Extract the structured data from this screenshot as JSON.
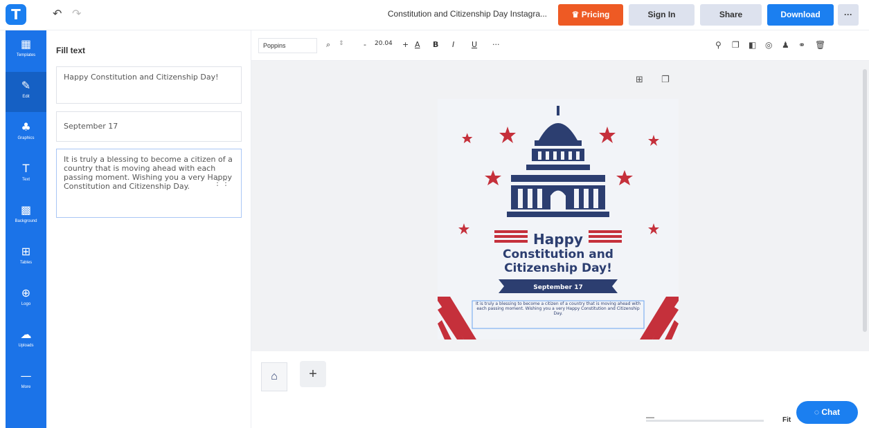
{
  "topbar": {
    "logo": "T",
    "undo_icon": "↶",
    "redo_icon": "↷",
    "title": "Constitution and Citizenship Day Instagra...",
    "pricing": "Pricing",
    "signin": "Sign In",
    "share": "Share",
    "download": "Download",
    "more": "···"
  },
  "sidebar": {
    "items": [
      {
        "icon": "▦",
        "label": "Templates"
      },
      {
        "icon": "✎",
        "label": "Edit"
      },
      {
        "icon": "♣",
        "label": "Graphics"
      },
      {
        "icon": "T",
        "label": "Text"
      },
      {
        "icon": "▩",
        "label": "Background"
      },
      {
        "icon": "⊞",
        "label": "Tables"
      },
      {
        "icon": "⊕",
        "label": "Logo"
      },
      {
        "icon": "☁",
        "label": "Uploads"
      },
      {
        "icon": "—",
        "label": "More"
      }
    ]
  },
  "panel": {
    "title": "Fill text",
    "texts": [
      "Happy Constitution and Citizenship Day!",
      "September 17",
      "It is truly a blessing to become a citizen of a country that is moving ahead with each passing moment. Wishing you a very Happy Constitution and Citizenship Day."
    ],
    "drag_icon": "⋮⋮"
  },
  "toolbar": {
    "font": "Poppins",
    "search_icon": "🔍",
    "font_size": "20.04",
    "minus": "-",
    "plus": "+",
    "underline_color_icon": "A",
    "bold": "B",
    "italic": "I",
    "underline": "U",
    "more": "···"
  },
  "canvas_labels": {
    "happy": "Happy",
    "line2": "Constitution and",
    "line3": "Citizenship Day!",
    "date": "September 17",
    "body": "It is truly a blessing to become a citizen of a country that is moving ahead with each passing moment. Wishing you a very Happy Constitution and Citizenship Day."
  },
  "colors": {
    "brand": "#1b73e8",
    "navy": "#2c3e70",
    "red": "#c5303b",
    "pricing": "#ee5a24"
  },
  "zoom": {
    "fit": "Fit"
  },
  "chat": "Chat"
}
